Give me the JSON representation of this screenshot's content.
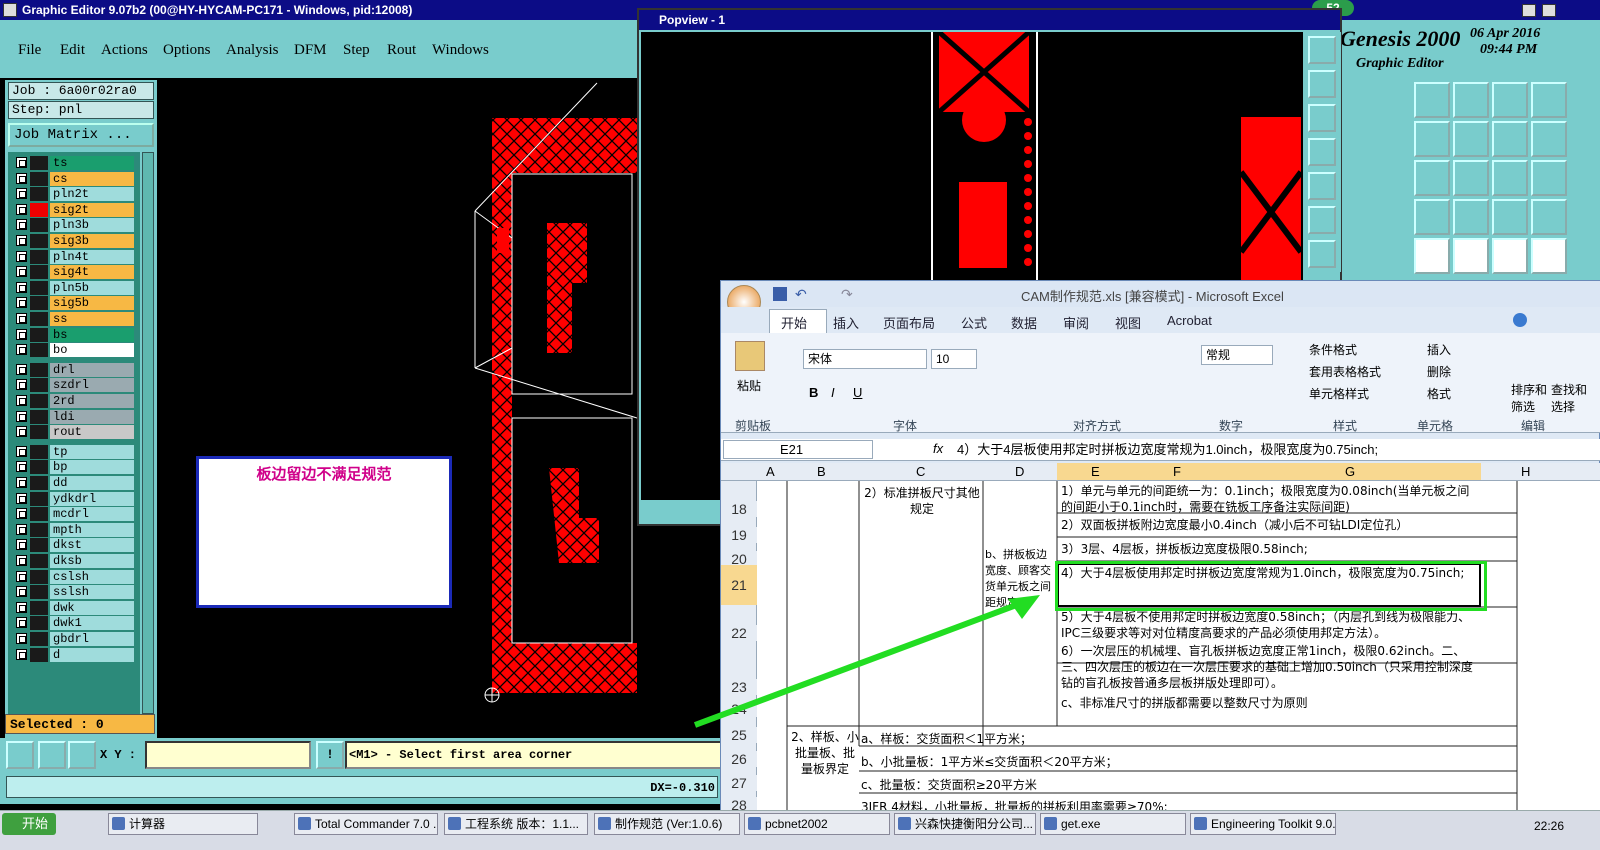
{
  "genesis": {
    "title": "Graphic Editor 9.07b2 (00@HY-HYCAM-PC171 - Windows, pid:12008)",
    "menu": [
      "File",
      "Edit",
      "Actions",
      "Options",
      "Analysis",
      "DFM",
      "Step",
      "Rout",
      "Windows"
    ],
    "job": "Job : 6a00r02ra0",
    "step": "Step: pnl",
    "job_matrix": "Job Matrix ...",
    "layers": [
      {
        "name": "ts",
        "color": "#1a9e6e"
      },
      {
        "name": "cs",
        "color": "#f7b844"
      },
      {
        "name": "pln2t",
        "color": "#9fdcdc"
      },
      {
        "name": "sig2t",
        "color": "#f7b844"
      },
      {
        "name": "pln3b",
        "color": "#9fdcdc"
      },
      {
        "name": "sig3b",
        "color": "#f7b844"
      },
      {
        "name": "pln4t",
        "color": "#9fdcdc"
      },
      {
        "name": "sig4t",
        "color": "#f7b844"
      },
      {
        "name": "pln5b",
        "color": "#9fdcdc"
      },
      {
        "name": "sig5b",
        "color": "#f7b844"
      },
      {
        "name": "ss",
        "color": "#f7b844"
      },
      {
        "name": "bs",
        "color": "#1a9e6e"
      },
      {
        "name": "bo",
        "color": "#ffffff"
      },
      {
        "name": "drl",
        "color": "#9aaab0"
      },
      {
        "name": "szdrl",
        "color": "#9aaab0"
      },
      {
        "name": "2rd",
        "color": "#9aaab0"
      },
      {
        "name": "ldi",
        "color": "#9aaab0"
      },
      {
        "name": "rout",
        "color": "#c8c8c8"
      },
      {
        "name": "tp",
        "color": "#9fdcdc"
      },
      {
        "name": "bp",
        "color": "#9fdcdc"
      },
      {
        "name": "dd",
        "color": "#9fdcdc"
      },
      {
        "name": "ydkdrl",
        "color": "#9fdcdc"
      },
      {
        "name": "mcdrl",
        "color": "#9fdcdc"
      },
      {
        "name": "mpth",
        "color": "#9fdcdc"
      },
      {
        "name": "dkst",
        "color": "#9fdcdc"
      },
      {
        "name": "dksb",
        "color": "#9fdcdc"
      },
      {
        "name": "cslsh",
        "color": "#9fdcdc"
      },
      {
        "name": "sslsh",
        "color": "#9fdcdc"
      },
      {
        "name": "dwk",
        "color": "#9fdcdc"
      },
      {
        "name": "dwk1",
        "color": "#9fdcdc"
      },
      {
        "name": "gbdrl",
        "color": "#9fdcdc"
      },
      {
        "name": "d",
        "color": "#9fdcdc"
      }
    ],
    "selected": "Selected : 0",
    "xy_label": "X Y :",
    "prompt": "<M1> - Select first area corner",
    "dx_readout": "DX=-0.310",
    "annotation": "板边留边不满足规范",
    "brand": "Genesis 2000",
    "brand_sub": "Graphic Editor",
    "date": "06 Apr 2016",
    "time": "09:44 PM",
    "badge": "52"
  },
  "popview": {
    "title": "Popview - 1"
  },
  "excel": {
    "title": "CAM制作规范.xls  [兼容模式] - Microsoft Excel",
    "tabs": [
      "开始",
      "插入",
      "页面布局",
      "公式",
      "数据",
      "审阅",
      "视图",
      "Acrobat"
    ],
    "font_name": "宋体",
    "font_size": "10",
    "number_format": "常规",
    "paste_label": "粘贴",
    "groups": [
      "剪贴板",
      "字体",
      "对齐方式",
      "数字",
      "样式",
      "单元格",
      "编辑"
    ],
    "style_items": [
      "条件格式",
      "套用表格格式",
      "单元格样式"
    ],
    "cell_items": [
      "插入",
      "删除",
      "格式"
    ],
    "edit_items": [
      "排序和筛选",
      "查找和选择"
    ],
    "name_box": "E21",
    "formula": "4）大于4层板使用邦定时拼板边宽度常规为1.0inch，极限宽度为0.75inch;",
    "columns": [
      "A",
      "B",
      "C",
      "D",
      "E",
      "F",
      "G",
      "H"
    ],
    "rows": [
      "18",
      "19",
      "20",
      "21",
      "22",
      "23",
      "24",
      "25",
      "26",
      "27",
      "28"
    ],
    "c_18": "2）标准拼板尺寸其他规定",
    "d_20": "b、拼板板边宽度、顾客交货单元板之间距规定",
    "e_18": "1）单元与单元的间距统一为：0.1inch；极限宽度为0.08inch(当单元板之间的间距小于0.1inch时，需要在铣板工序备注实际间距)",
    "e_19": "2）双面板拼板附边宽度最小0.4inch（减小后不可钻LDI定位孔）",
    "e_20": "3）3层、4层板，拼板板边宽度极限0.58inch;",
    "e_21": "4）大于4层板使用邦定时拼板边宽度常规为1.0inch，极限宽度为0.75inch;",
    "e_22": "5）大于4层板不使用邦定时拼板边宽度0.58inch；（内层孔到线为极限能力、IPC三级要求等对对位精度高要求的产品必须使用邦定方法）。",
    "e_23": "6）一次层压的机械埋、盲孔板拼板边宽度正常1inch，极限0.62inch。二、三、四次层压的板边在一次层压要求的基础上增加0.50inch（只采用控制深度钻的盲孔板按普通多层板拼版处理即可）。",
    "d_24": "c、非标准尺寸的拼版都需要以整数尺寸为原则",
    "b_25": "2、样板、小批量板、批量板界定",
    "c_25": "a、样板：交货面积＜1平方米；",
    "c_26": "b、小批量板：1平方米≤交货面积＜20平方米；",
    "c_27": "c、批量板：交货面积≥20平方米",
    "c_28": "3IFR 4材料，小批量板，批量板的拼板利用率需要≥70%;"
  },
  "taskbar": {
    "start": "开始",
    "tasks": [
      "计算器",
      "Total Commander 7.0 ...",
      "工程系统  版本：1.1...",
      "制作规范 (Ver:1.0.6)",
      "pcbnet2002",
      "兴森快捷衡阳分公司...",
      "get.exe",
      "Engineering Toolkit 9.0..."
    ],
    "clock": "22:26"
  },
  "colors": {
    "genesis_bg": "#79cccc",
    "titlebar": "#0c0c86",
    "copper": "#ff0000",
    "highlight": "#22dd22",
    "annotation": "#d0008a"
  }
}
